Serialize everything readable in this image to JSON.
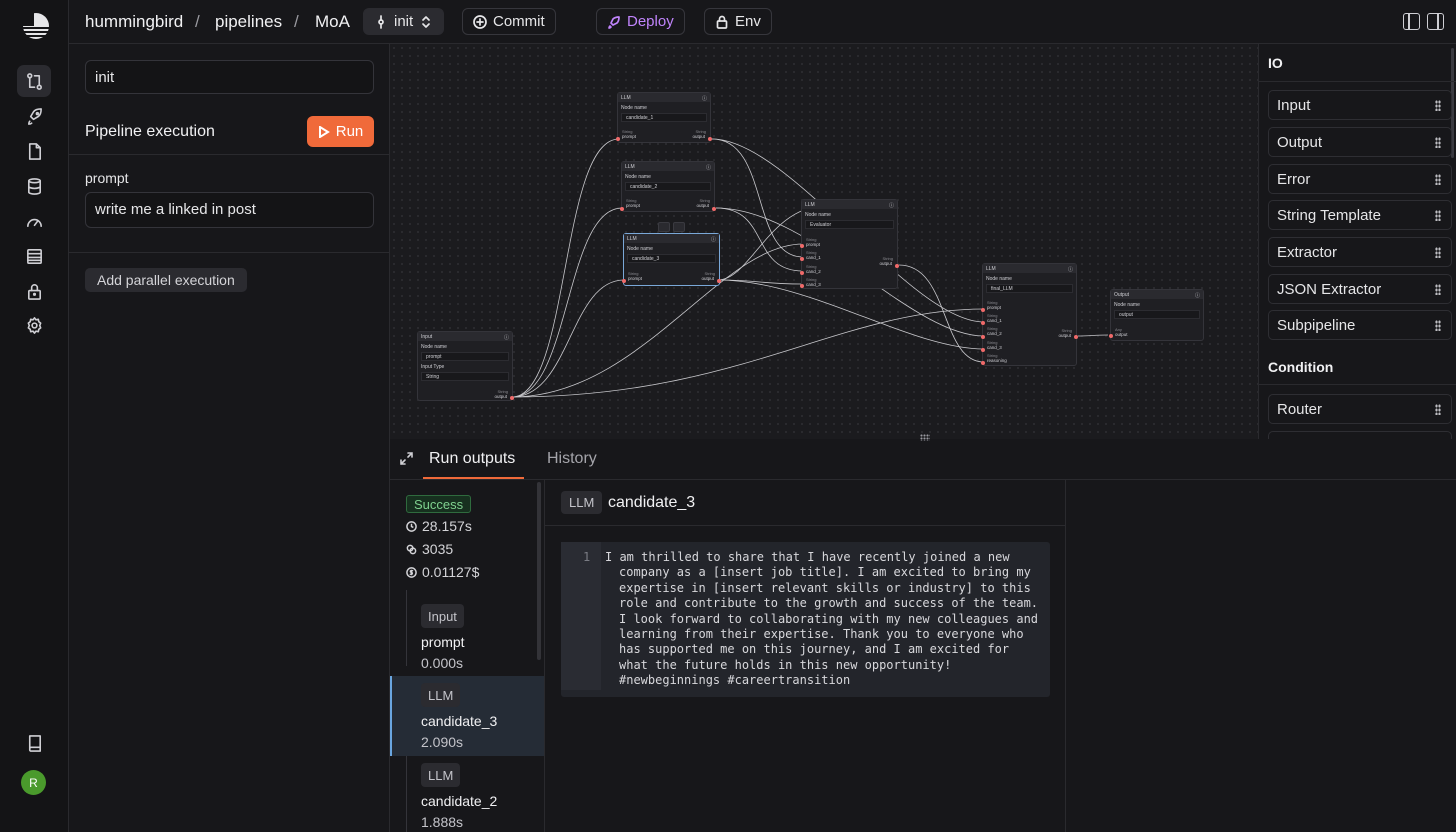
{
  "breadcrumb": {
    "org": "hummingbird",
    "section": "pipelines",
    "pipeline": "MoA",
    "sep": "/"
  },
  "toolbar": {
    "branch": "init",
    "commit": "Commit",
    "deploy": "Deploy",
    "env": "Env"
  },
  "left": {
    "version_value": "init",
    "title": "Pipeline execution",
    "run_label": "Run",
    "param_label": "prompt",
    "param_value": "write me a linked in post",
    "add_parallel": "Add parallel execution"
  },
  "nodes": {
    "n1": {
      "type": "LLM",
      "name_label": "Node name",
      "name": "candidate_1",
      "in_type": "String",
      "in": "prompt",
      "out_type": "String",
      "out": "output"
    },
    "n2": {
      "type": "LLM",
      "name_label": "Node name",
      "name": "candidate_2",
      "in_type": "String",
      "in": "prompt",
      "out_type": "String",
      "out": "output"
    },
    "n3": {
      "type": "LLM",
      "name_label": "Node name",
      "name": "candidate_3",
      "in_type": "String",
      "in": "prompt",
      "out_type": "String",
      "out": "output"
    },
    "input": {
      "type": "Input",
      "name_label": "Node name",
      "name": "prompt",
      "type_label": "Input Type",
      "type_value": "String",
      "out_type": "String",
      "out": "output"
    },
    "eval": {
      "type": "LLM",
      "name_label": "Node name",
      "name": "Evaluator",
      "ports": [
        "prompt",
        "cand_1",
        "cand_2",
        "cand_3"
      ],
      "in_type": "String",
      "out_type": "String",
      "out": "output"
    },
    "final": {
      "type": "LLM",
      "name_label": "Node name",
      "name": "final_LLM",
      "ports": [
        "prompt",
        "cand_1",
        "cand_2",
        "cand_3",
        "reasoning"
      ],
      "in_type": "String",
      "out_type": "String",
      "out": "output"
    },
    "output": {
      "type": "Output",
      "name_label": "Node name",
      "name": "output",
      "in_type": "Any",
      "in": "output"
    }
  },
  "right": {
    "io_title": "IO",
    "io_items": [
      "Input",
      "Output",
      "Error",
      "String Template",
      "Extractor",
      "JSON Extractor",
      "Subpipeline"
    ],
    "cond_title": "Condition",
    "cond_items": [
      "Router"
    ]
  },
  "bottom": {
    "tab_outputs": "Run outputs",
    "tab_history": "History",
    "status": "Success",
    "duration": "28.157s",
    "tokens": "3035",
    "cost": "0.01127$",
    "runs": [
      {
        "tag": "Input",
        "name": "prompt",
        "time": "0.000s"
      },
      {
        "tag": "LLM",
        "name": "candidate_3",
        "time": "2.090s"
      },
      {
        "tag": "LLM",
        "name": "candidate_2",
        "time": "1.888s"
      }
    ],
    "output_tag": "LLM",
    "output_name": "candidate_3",
    "line_no": "1",
    "output_text": "I am thrilled to share that I have recently joined a new company as a [insert job title]. I am excited to bring my expertise in [insert relevant skills or industry] to this role and contribute to the growth and success of the team. I look forward to collaborating with my new colleagues and learning from their expertise. Thank you to everyone who has supported me on this journey, and I am excited for what the future holds in this new opportunity! #newbeginnings #careertransition"
  },
  "user": {
    "initial": "R",
    "avatar_color": "#4a9a2c"
  },
  "colors": {
    "accent": "#f06a3a",
    "deploy": "#c084fc",
    "success": "#7fd18f"
  }
}
